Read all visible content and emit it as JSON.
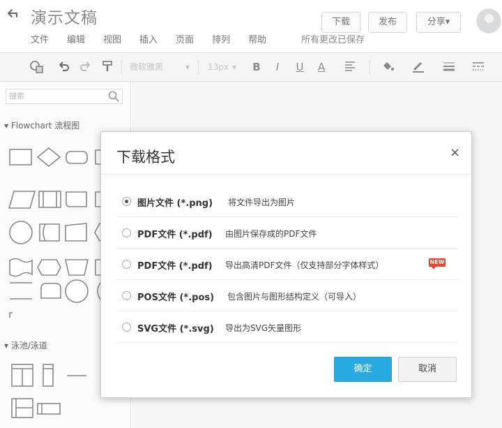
{
  "header": {
    "back_icon": "back-arrow-icon",
    "title": "演示文稿",
    "menu": [
      "文件",
      "编辑",
      "视图",
      "插入",
      "页面",
      "排列",
      "帮助"
    ],
    "save_status": "所有更改已保存",
    "download_label": "下载",
    "publish_label": "发布",
    "share_label": "分享▾"
  },
  "toolbar": {
    "font_select": "微软雅黑",
    "font_size": "13px",
    "bold": "B",
    "italic": "I",
    "underline": "U",
    "font_color": "A"
  },
  "sidebar": {
    "search_placeholder": "搜索",
    "section1": "Flowchart 流程图",
    "section2": "泳池/泳道"
  },
  "dialog": {
    "title": "下载格式",
    "close": "×",
    "options": [
      {
        "name": "图片文件 (*.png)",
        "desc": "将文件导出为图片",
        "checked": true
      },
      {
        "name": "PDF文件 (*.pdf)",
        "desc": "由图片保存成的PDF文件",
        "checked": false
      },
      {
        "name": "PDF文件 (*.pdf)",
        "desc": "导出高清PDF文件（仅支持部分字体样式）",
        "checked": false,
        "badge": "NEW"
      },
      {
        "name": "POS文件 (*.pos)",
        "desc": "包含图片与图形结构定义（可导入）",
        "checked": false
      },
      {
        "name": "SVG文件 (*.svg)",
        "desc": "导出为SVG矢量图形",
        "checked": false
      }
    ],
    "confirm_label": "确定",
    "cancel_label": "取消"
  },
  "colors": {
    "accent": "#29abe2",
    "badge": "#e8432e"
  }
}
